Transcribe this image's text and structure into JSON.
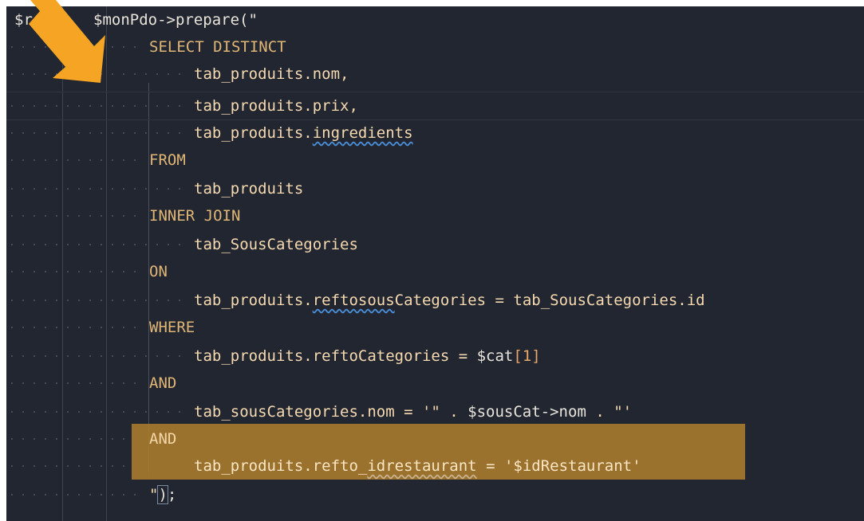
{
  "editor": {
    "lines": [
      {
        "prefix": "$r",
        "code": "$monPdo->prepare(\""
      },
      {
        "keyword": "SELECT DISTINCT"
      },
      {
        "code": "tab_produits.nom,"
      },
      {
        "code": "tab_produits.prix,"
      },
      {
        "code_a": "tab_produits.",
        "code_b": "ingredients"
      },
      {
        "keyword": "FROM"
      },
      {
        "code": "tab_produits"
      },
      {
        "keyword": "INNER JOIN"
      },
      {
        "code": "tab_SousCategories"
      },
      {
        "keyword": "ON"
      },
      {
        "code_a": "tab_produits.",
        "code_b": "reftosous",
        "code_c": "Categories = tab_SousCategories.id"
      },
      {
        "keyword": "WHERE"
      },
      {
        "code_a": "tab_produits.reftoCategories = ",
        "code_b": "$cat",
        "code_c": "[1]"
      },
      {
        "keyword": "AND"
      },
      {
        "code_a": "tab_sousCategories.nom = '\" . ",
        "code_b": "$sousCat->nom",
        "code_c": " . \"'"
      },
      {
        "keyword": "AND"
      },
      {
        "code_a": "tab_produits.refto_",
        "code_b": "idrestaurant",
        "code_c": " = '$idRestaurant'"
      },
      {
        "code_a": "\"",
        "code_b": ")",
        "code_c": ";"
      }
    ]
  },
  "colors": {
    "editor_bg": "#222630",
    "highlight": "#a87a2f",
    "arrow": "#f5a423",
    "keyword": "#e0b676"
  },
  "icons": [
    "arrow-annotation-icon"
  ]
}
